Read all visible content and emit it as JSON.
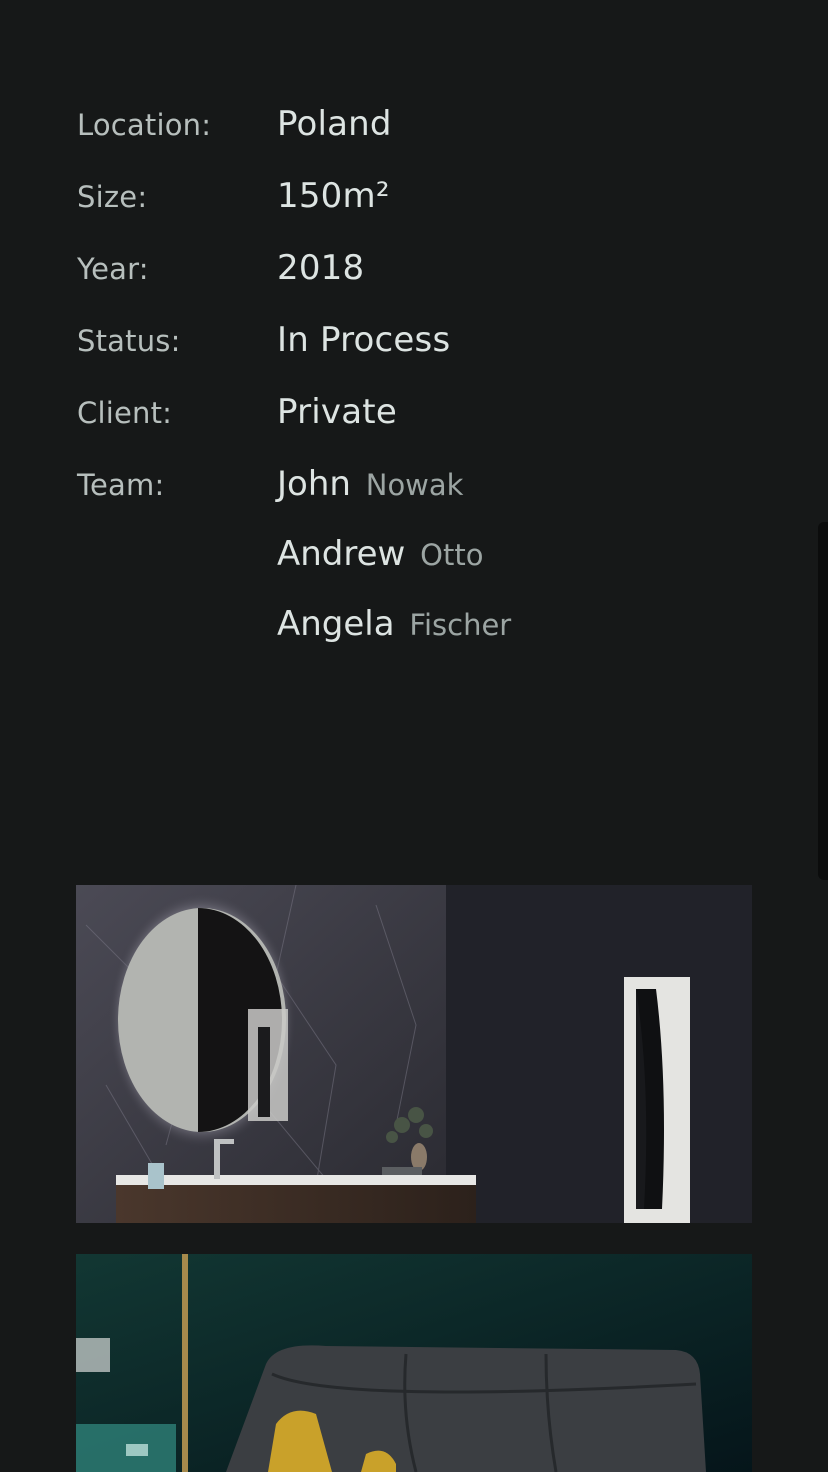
{
  "details": {
    "location": {
      "label": "Location:",
      "value": "Poland"
    },
    "size": {
      "label": "Size:",
      "value": "150m²"
    },
    "year": {
      "label": "Year:",
      "value": "2018"
    },
    "status": {
      "label": "Status:",
      "value": "In Process"
    },
    "client": {
      "label": "Client:",
      "value": "Private"
    },
    "team": {
      "label": "Team:",
      "members": [
        {
          "first": "John",
          "last": "Nowak"
        },
        {
          "first": "Andrew",
          "last": "Otto"
        },
        {
          "first": "Angela",
          "last": "Fischer"
        }
      ]
    }
  },
  "gallery": {
    "images": [
      {
        "name": "bathroom-photo"
      },
      {
        "name": "living-room-photo"
      }
    ]
  },
  "colors": {
    "background": "#161818",
    "label": "#b7bfbd",
    "value": "#dde4e2",
    "muted": "#9ca5a3"
  }
}
